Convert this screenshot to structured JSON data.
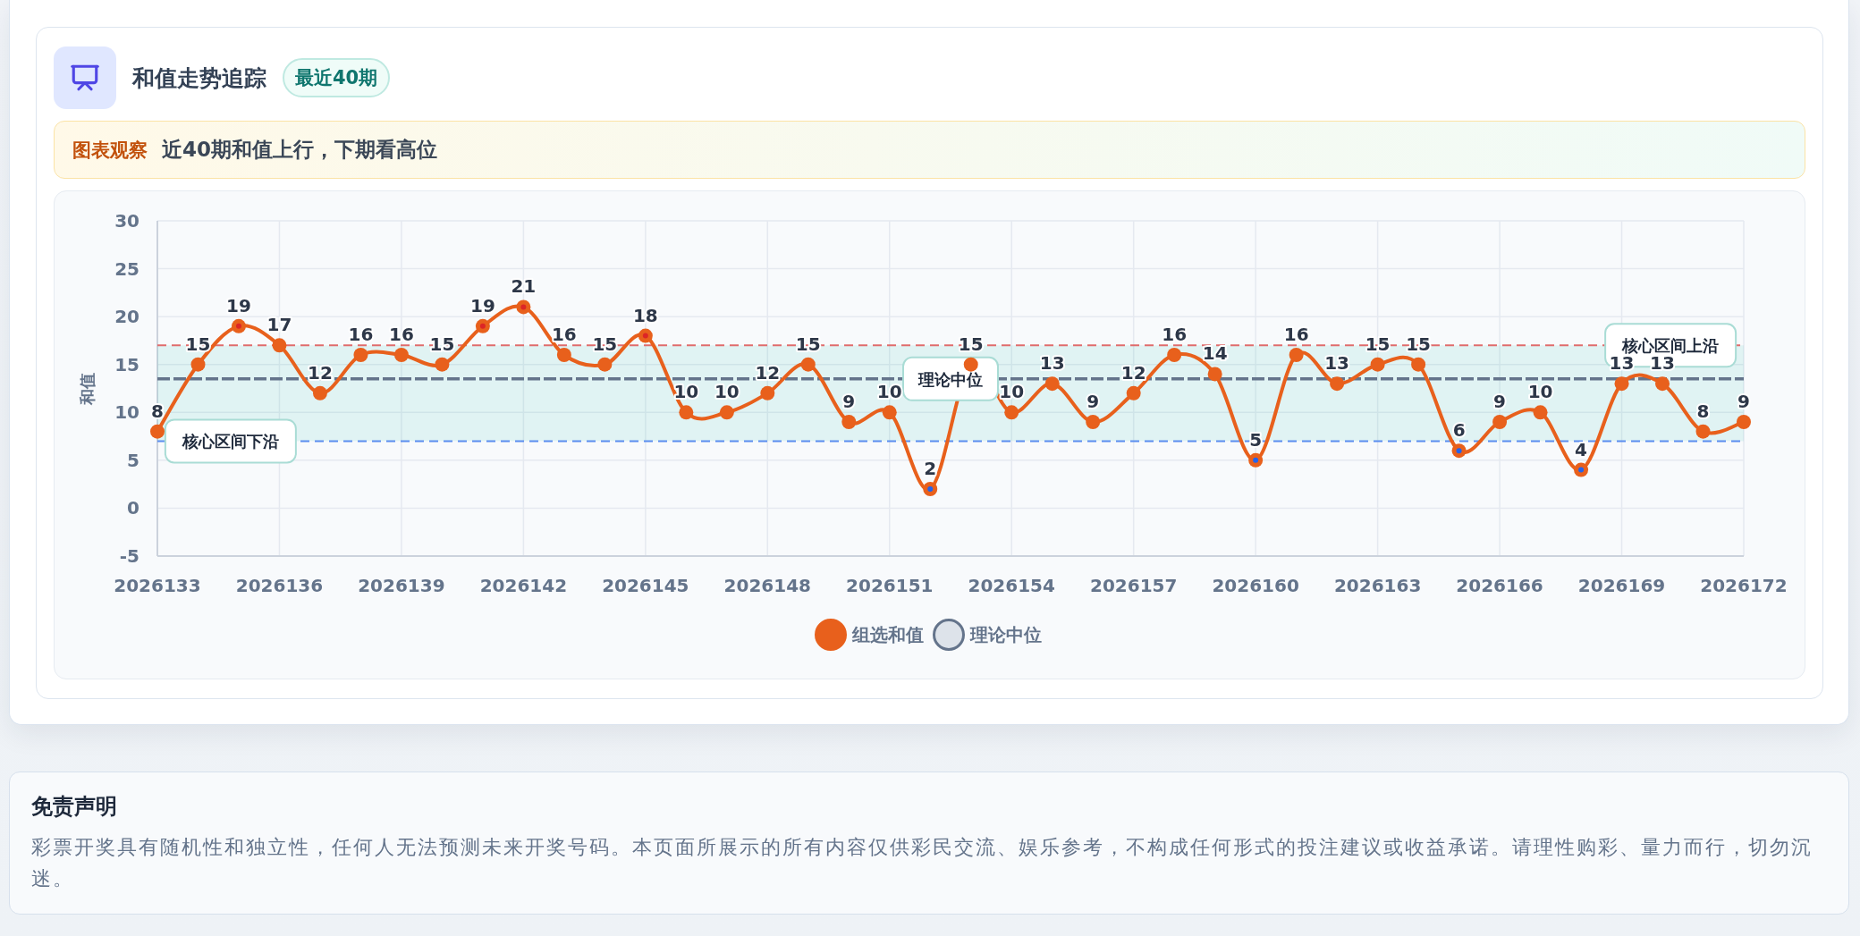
{
  "trend_card": {
    "title": "和值走势追踪",
    "badge": "最近40期",
    "observation": {
      "label": "图表观察",
      "text": "近40期和值上行，下期看高位"
    },
    "chart": {
      "chart_data": {
        "type": "line",
        "ylabel": "和值",
        "categories": [
          "2026133",
          null,
          null,
          "2026136",
          null,
          null,
          "2026139",
          null,
          null,
          "2026142",
          null,
          null,
          "2026145",
          null,
          null,
          "2026148",
          null,
          null,
          "2026151",
          null,
          null,
          "2026154",
          null,
          null,
          "2026157",
          null,
          null,
          "2026160",
          null,
          null,
          "2026163",
          null,
          null,
          "2026166",
          null,
          null,
          "2026169",
          null,
          null,
          "2026172"
        ],
        "series": [
          {
            "name": "组选和值",
            "color": "#e8601c",
            "marker": "circle",
            "values": [
              8,
              15,
              19,
              17,
              12,
              16,
              16,
              15,
              19,
              21,
              16,
              15,
              18,
              10,
              10,
              12,
              15,
              9,
              10,
              2,
              15,
              10,
              13,
              9,
              12,
              16,
              14,
              5,
              16,
              13,
              15,
              15,
              6,
              9,
              10,
              4,
              13,
              13,
              8,
              9
            ]
          }
        ],
        "ylim": [
          -5,
          30
        ],
        "yticks": [
          -5,
          0,
          5,
          10,
          15,
          20,
          25,
          30
        ],
        "grid": true,
        "data_labels": true,
        "bands": [
          {
            "axis": "y",
            "from": 7,
            "to": 17,
            "color": "#14b8a6"
          }
        ],
        "ref_lines": [
          {
            "axis": "y",
            "value": 13.5,
            "label": "理论中位",
            "color": "#64748b",
            "line_style": "dashed"
          },
          {
            "axis": "y",
            "value": 17,
            "label": "核心区间上沿",
            "color": "#e06c6c",
            "line_style": "dashed"
          },
          {
            "axis": "y",
            "value": 7,
            "label": "核心区间下沿",
            "color": "#5b8def",
            "line_style": "dashed"
          }
        ]
      },
      "legend": [
        {
          "label": "理论中位",
          "color": "#64748b"
        }
      ]
    }
  },
  "disclaimer": {
    "title": "免责声明",
    "text": "彩票开奖具有随机性和独立性，任何人无法预测未来开奖号码。本页面所展示的所有内容仅供彩民交流、娱乐参考，不构成任何形式的投注建议或收益承诺。请理性购彩、量力而行，切勿沉迷。"
  }
}
